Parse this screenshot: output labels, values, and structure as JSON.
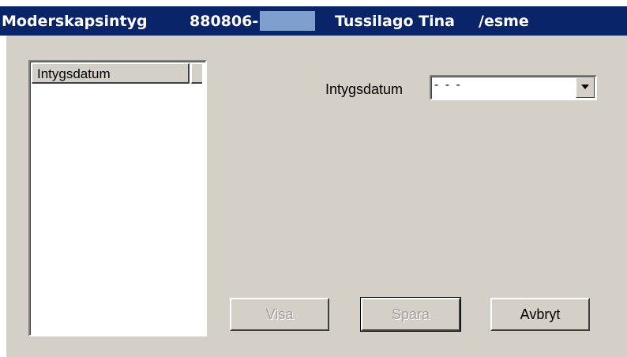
{
  "titlebar": {
    "app": "Moderskapsintyg",
    "personal_number": "880806-",
    "patient_name": "Tussilago Tina",
    "user": "/esme"
  },
  "list": {
    "column_header": "Intygsdatum",
    "items": []
  },
  "form": {
    "date_label": "Intygsdatum",
    "date_value": "- - -"
  },
  "buttons": {
    "show": "Visa",
    "save": "Spara",
    "cancel": "Avbryt"
  },
  "colors": {
    "titlebar": "#0a246a",
    "face": "#d4d0c8",
    "redaction": "#7f9fcc"
  }
}
